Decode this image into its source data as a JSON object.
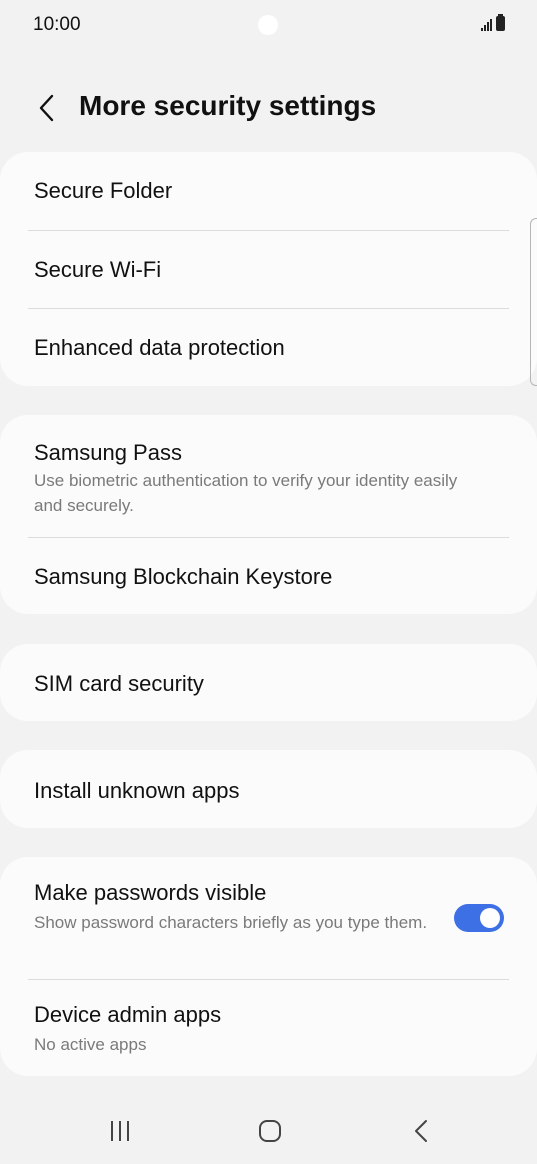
{
  "status_bar": {
    "time": "10:00"
  },
  "header": {
    "title": "More security settings"
  },
  "groups": [
    {
      "items": [
        {
          "title": "Secure Folder"
        },
        {
          "title": "Secure Wi-Fi"
        },
        {
          "title": "Enhanced data protection"
        }
      ]
    },
    {
      "items": [
        {
          "title": "Samsung Pass",
          "subtitle": "Use biometric authentication to verify your identity easily and securely."
        },
        {
          "title": "Samsung Blockchain Keystore"
        }
      ]
    },
    {
      "items": [
        {
          "title": "SIM card security"
        }
      ]
    },
    {
      "items": [
        {
          "title": "Install unknown apps"
        }
      ]
    },
    {
      "items": [
        {
          "title": "Make passwords visible",
          "subtitle": "Show password characters briefly as you type them.",
          "toggle_on": true
        },
        {
          "title": "Device admin apps",
          "subtitle": "No active apps"
        }
      ]
    }
  ],
  "colors": {
    "accent": "#3d6fe5",
    "background": "#f2f2f2",
    "card": "#fbfbfb"
  }
}
